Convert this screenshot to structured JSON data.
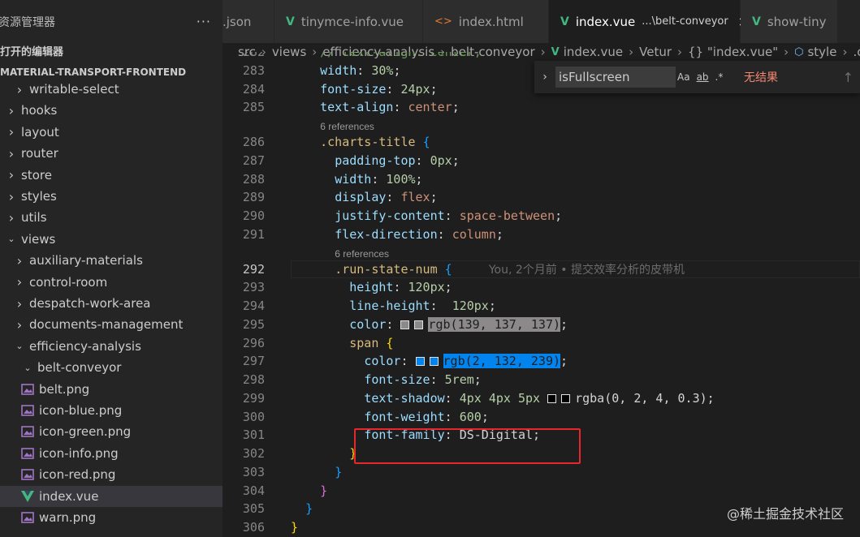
{
  "sidebar": {
    "title": "资源管理器",
    "more": "···",
    "open_editors": "打开的编辑器",
    "project": "MATERIAL-TRANSPORT-FRONTEND",
    "items": [
      {
        "label": "writable-select",
        "type": "folder",
        "indent": 1
      },
      {
        "label": "hooks",
        "type": "folder",
        "indent": 0
      },
      {
        "label": "layout",
        "type": "folder",
        "indent": 0
      },
      {
        "label": "router",
        "type": "folder",
        "indent": 0
      },
      {
        "label": "store",
        "type": "folder",
        "indent": 0
      },
      {
        "label": "styles",
        "type": "folder",
        "indent": 0
      },
      {
        "label": "utils",
        "type": "folder",
        "indent": 0
      },
      {
        "label": "views",
        "type": "folder-open",
        "indent": 0
      },
      {
        "label": "auxiliary-materials",
        "type": "folder",
        "indent": 1
      },
      {
        "label": "control-room",
        "type": "folder",
        "indent": 1
      },
      {
        "label": "despatch-work-area",
        "type": "folder",
        "indent": 1
      },
      {
        "label": "documents-management",
        "type": "folder",
        "indent": 1
      },
      {
        "label": "efficiency-analysis",
        "type": "folder-open",
        "indent": 1
      },
      {
        "label": "belt-conveyor",
        "type": "folder-open",
        "indent": 2
      },
      {
        "label": "belt.png",
        "type": "image",
        "indent": 3
      },
      {
        "label": "icon-blue.png",
        "type": "image",
        "indent": 3
      },
      {
        "label": "icon-green.png",
        "type": "image",
        "indent": 3
      },
      {
        "label": "icon-info.png",
        "type": "image",
        "indent": 3
      },
      {
        "label": "icon-red.png",
        "type": "image",
        "indent": 3
      },
      {
        "label": "index.vue",
        "type": "vue",
        "indent": 3,
        "active": true
      },
      {
        "label": "warn.png",
        "type": "image",
        "indent": 3
      }
    ]
  },
  "tabs": [
    {
      "label": ".json",
      "icon": "none"
    },
    {
      "label": "tinymce-info.vue",
      "icon": "vue-icon"
    },
    {
      "label": "index.html",
      "icon": "html-icon"
    },
    {
      "label": "index.vue",
      "desc": "...\\belt-conveyor",
      "icon": "vue-icon",
      "active": true,
      "close": "×"
    },
    {
      "label": "show-tiny",
      "icon": "vue-icon"
    }
  ],
  "breadcrumb": [
    "src",
    "views",
    "efficiency-analysis",
    "belt-conveyor",
    "index.vue",
    "Vetur",
    "{} \"index.vue\"",
    "style",
    ".cont"
  ],
  "find": {
    "query": "isFullscreen",
    "opt_case": "Aa",
    "opt_word": "ab",
    "opt_regex": ".*",
    "result": "无结果",
    "up": "↑"
  },
  "lens": {
    "l286": "6 references",
    "l292": "6 references"
  },
  "blame": "You, 2个月前 • 提交效率分析的皮带机",
  "colors": {
    "grey": "#8b8989",
    "blue": "#0284ef",
    "shadow": "#000204",
    "highlight_border": "#e8262b"
  },
  "code": {
    "l282": "// text-align: center;",
    "l283_p": "width",
    "l283_v": "30%",
    "l284_p": "font-size",
    "l284_v": "24px",
    "l285_p": "text-align",
    "l285_v": "center",
    "l286_s": ".charts-title",
    "l287_p": "padding-top",
    "l287_v": "0px",
    "l288_p": "width",
    "l288_v": "100%",
    "l289_p": "display",
    "l289_v": "flex",
    "l290_p": "justify-content",
    "l290_v": "space-between",
    "l291_p": "flex-direction",
    "l291_v": "column",
    "l292_s": ".run-state-num",
    "l293_p": "height",
    "l293_v": "120px",
    "l294_p": "line-height",
    "l294_v": "120px",
    "l295_p": "color",
    "l295_v": "rgb(139, 137, 137)",
    "l296_s": "span",
    "l297_p": "color",
    "l297_v": "rgb(2, 132, 239)",
    "l298_p": "font-size",
    "l298_v": "5rem",
    "l299_p": "text-shadow",
    "l299_v": "4px 4px 5px",
    "l299_c": "rgba(0, 2, 4, 0.3)",
    "l300_p": "font-weight",
    "l300_v": "600",
    "l301_p": "font-family",
    "l301_v": "DS-Digital"
  },
  "line_numbers": [
    "282",
    "283",
    "284",
    "285",
    "286",
    "287",
    "288",
    "289",
    "290",
    "291",
    "292",
    "293",
    "294",
    "295",
    "296",
    "297",
    "298",
    "299",
    "300",
    "301",
    "302",
    "303",
    "304",
    "305",
    "306"
  ],
  "watermark": "@稀土掘金技术社区"
}
